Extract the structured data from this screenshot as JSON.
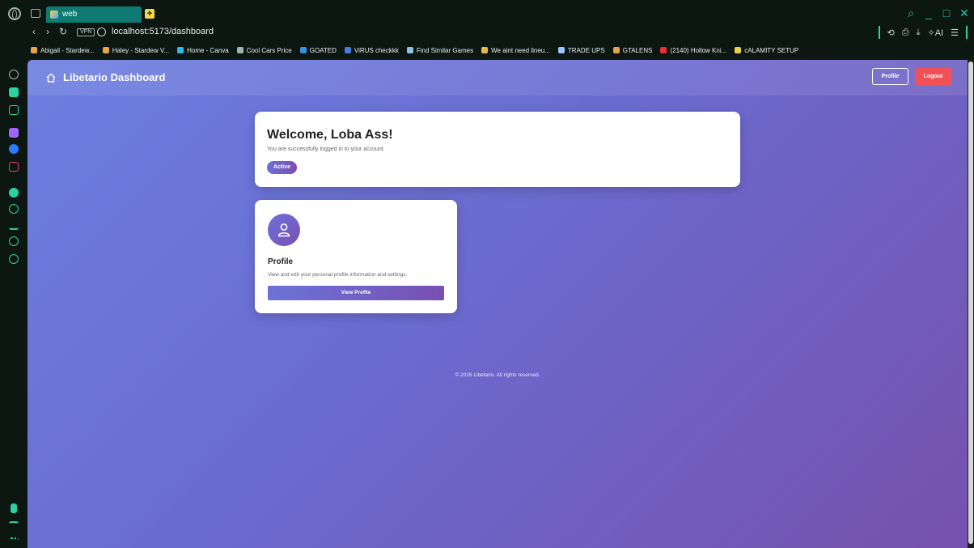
{
  "browser": {
    "tab_title": "web",
    "url": "localhost:5173/dashboard",
    "vpn_label": "VPN",
    "ai_label": "AI",
    "bookmarks": [
      {
        "label": "Abigail - Stardew...",
        "color": "#e8a24a"
      },
      {
        "label": "Haley - Stardew V...",
        "color": "#e8a24a"
      },
      {
        "label": "Home - Canva",
        "color": "#2fb8e8"
      },
      {
        "label": "Cool Cars Price",
        "color": "#9fb5ad"
      },
      {
        "label": "GOATED",
        "color": "#3a8fe0"
      },
      {
        "label": "ViRUS checkkk",
        "color": "#4a7be0"
      },
      {
        "label": "Find Similar Games",
        "color": "#8fc0e8"
      },
      {
        "label": "We aint need lineu...",
        "color": "#e8b84a"
      },
      {
        "label": "TRADE UPS",
        "color": "#a0c0ff"
      },
      {
        "label": "GTALENS",
        "color": "#e8a24a"
      },
      {
        "label": "(2140) Hollow Kni...",
        "color": "#e83030"
      },
      {
        "label": "cALAMITY SETUP",
        "color": "#e8d04a"
      }
    ]
  },
  "app": {
    "brand": "Libetario Dashboard",
    "header_profile": "Profile",
    "header_logout": "Logout"
  },
  "welcome": {
    "title": "Welcome, Loba Ass!",
    "subtitle": "You are successfully logged in to your account.",
    "badge": "Active"
  },
  "profile_card": {
    "title": "Profile",
    "description": "View and edit your personal profile information and settings.",
    "button": "View Profile"
  },
  "footer": "© 2026 Libetario. All rights reserved."
}
